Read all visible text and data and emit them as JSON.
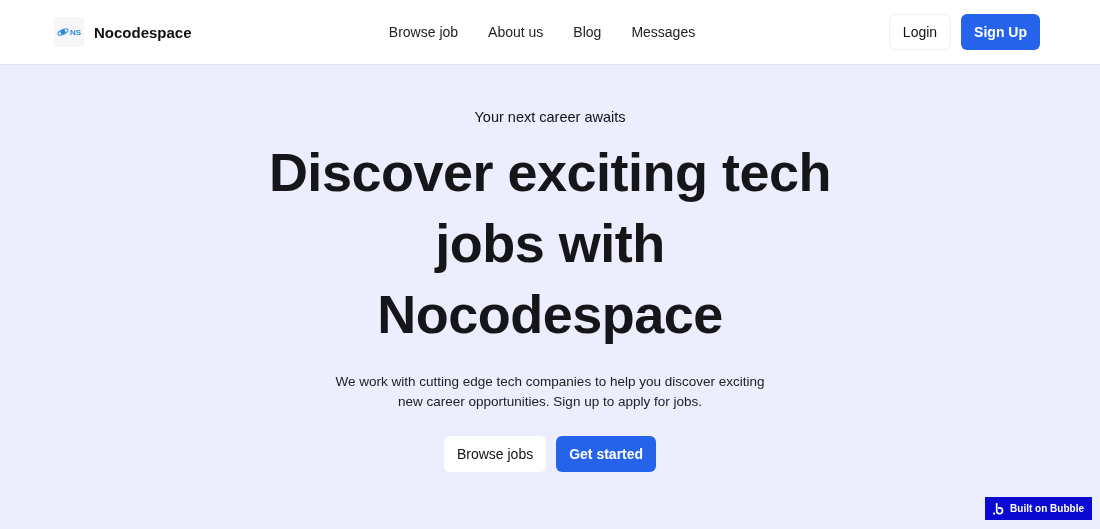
{
  "header": {
    "logo_text": "NS",
    "brand": "Nocodespace",
    "nav": [
      {
        "label": "Browse job"
      },
      {
        "label": "About us"
      },
      {
        "label": "Blog"
      },
      {
        "label": "Messages"
      }
    ],
    "login": "Login",
    "signup": "Sign Up"
  },
  "hero": {
    "eyebrow": "Your next career awaits",
    "title": "Discover exciting tech\njobs with\nNocodespace",
    "description": "We work with cutting edge tech companies to help you discover exciting new career opportunities. Sign up to apply for jobs.",
    "buttons": [
      {
        "label": "Browse jobs",
        "kind": "secondary"
      },
      {
        "label": "Get started",
        "kind": "primary"
      }
    ]
  },
  "badge": {
    "label": "Built on Bubble"
  }
}
